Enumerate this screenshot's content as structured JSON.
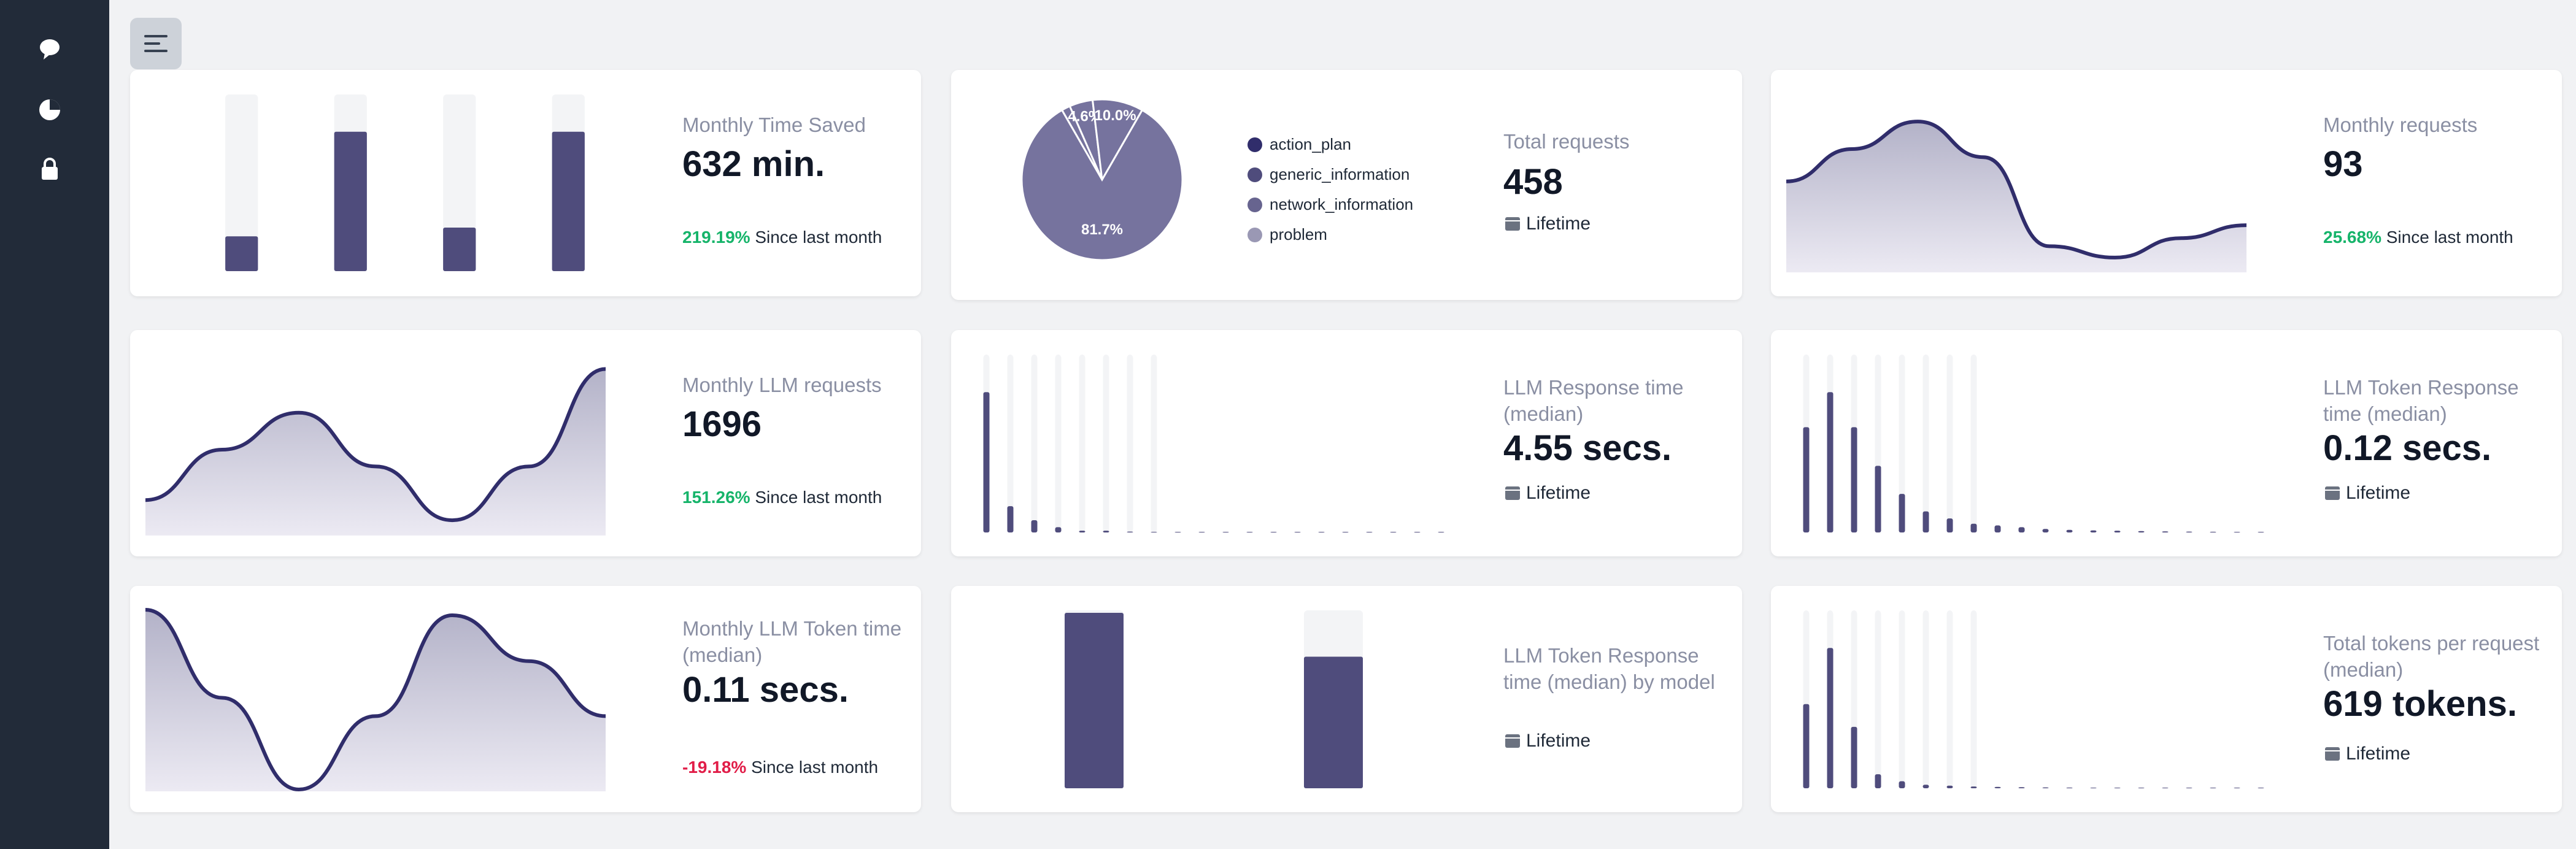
{
  "colors": {
    "sidebar": "#222b39",
    "bar": "#4f4c7c",
    "track": "#f3f4f6",
    "line": "#302d6b",
    "area": "#b3b2c8",
    "positive": "#16b46a",
    "negative": "#e11d48"
  },
  "sidebar": {
    "icons": [
      "chat-bubble-icon",
      "pie-chart-icon",
      "lock-icon"
    ]
  },
  "header": {
    "menu_icon": "hamburger-menu-icon"
  },
  "cards": {
    "time_saved": {
      "label": "Monthly Time Saved",
      "value": "632 min.",
      "change": "219.19%",
      "change_suffix": "Since last month"
    },
    "total_requests": {
      "label": "Total requests",
      "value": "458",
      "footer": "Lifetime"
    },
    "monthly_requests": {
      "label": "Monthly requests",
      "value": "93",
      "change": "25.68%",
      "change_suffix": "Since last month"
    },
    "llm_requests": {
      "label": "Monthly LLM requests",
      "value": "1696",
      "change": "151.26%",
      "change_suffix": "Since last month"
    },
    "llm_response_time": {
      "label": "LLM Response time (median)",
      "value": "4.55 secs.",
      "footer": "Lifetime"
    },
    "llm_token_response": {
      "label": "LLM Token Response time (median)",
      "value": "0.12 secs.",
      "footer": "Lifetime"
    },
    "monthly_llm_token": {
      "label": "Monthly LLM Token time (median)",
      "value": "0.11 secs.",
      "change": "-19.18%",
      "change_suffix": "Since last month"
    },
    "llm_token_by_model": {
      "label": "LLM Token Response time (median) by model",
      "footer": "Lifetime"
    },
    "tokens_per_request": {
      "label": "Total tokens per request (median)",
      "value": "619 tokens.",
      "footer": "Lifetime"
    }
  },
  "chart_data": [
    {
      "type": "bar",
      "id": "time_saved",
      "values": [
        0.2,
        0.8,
        0.25,
        0.8
      ],
      "ylim": [
        0,
        1
      ]
    },
    {
      "type": "pie",
      "id": "total_requests",
      "labels": [
        "action_plan",
        "generic_information",
        "network_information",
        "problem"
      ],
      "values": [
        1.7,
        4.6,
        10.0,
        81.7
      ],
      "data_labels": [
        "",
        "4.6%",
        "10.0%",
        "81.7%"
      ],
      "colors": [
        "#302d6b",
        "#4f4c7c",
        "#67648f",
        "#9a98b4"
      ],
      "legend": "right"
    },
    {
      "type": "area",
      "id": "monthly_requests",
      "values": [
        0.55,
        0.75,
        0.92,
        0.7,
        0.15,
        0.08,
        0.2,
        0.28
      ],
      "ylim": [
        0,
        1
      ]
    },
    {
      "type": "area",
      "id": "llm_requests",
      "values": [
        0.2,
        0.5,
        0.72,
        0.4,
        0.08,
        0.4,
        0.98
      ],
      "ylim": [
        0,
        1
      ]
    },
    {
      "type": "bar",
      "id": "llm_response_time",
      "values": [
        0.8,
        0.15,
        0.07,
        0.03,
        0.01,
        0.01,
        0.005,
        0.003,
        0.003,
        0.002,
        0.002,
        0.001,
        0.001,
        0.001,
        0.001,
        0.001,
        0.001,
        0.001,
        0.001,
        0.001
      ],
      "ylim": [
        0,
        1
      ],
      "tracks": 8
    },
    {
      "type": "bar",
      "id": "llm_token_response",
      "values": [
        0.6,
        0.8,
        0.6,
        0.38,
        0.22,
        0.12,
        0.08,
        0.05,
        0.04,
        0.03,
        0.02,
        0.015,
        0.012,
        0.01,
        0.008,
        0.006,
        0.005,
        0.004,
        0.003,
        0.003
      ],
      "ylim": [
        0,
        1
      ],
      "tracks": 8
    },
    {
      "type": "area",
      "id": "monthly_llm_token",
      "values": [
        0.98,
        0.5,
        0.0,
        0.4,
        0.95,
        0.7,
        0.4
      ],
      "ylim": [
        0,
        1
      ]
    },
    {
      "type": "bar",
      "id": "llm_token_by_model",
      "values": [
        1.0,
        0.75
      ],
      "ylim": [
        0,
        1
      ]
    },
    {
      "type": "bar",
      "id": "tokens_per_request",
      "values": [
        0.48,
        0.8,
        0.35,
        0.08,
        0.04,
        0.02,
        0.015,
        0.01,
        0.008,
        0.006,
        0.005,
        0.004,
        0.003,
        0.003,
        0.002,
        0.002,
        0.002,
        0.001,
        0.001,
        0.001
      ],
      "ylim": [
        0,
        1
      ],
      "tracks": 8
    }
  ]
}
